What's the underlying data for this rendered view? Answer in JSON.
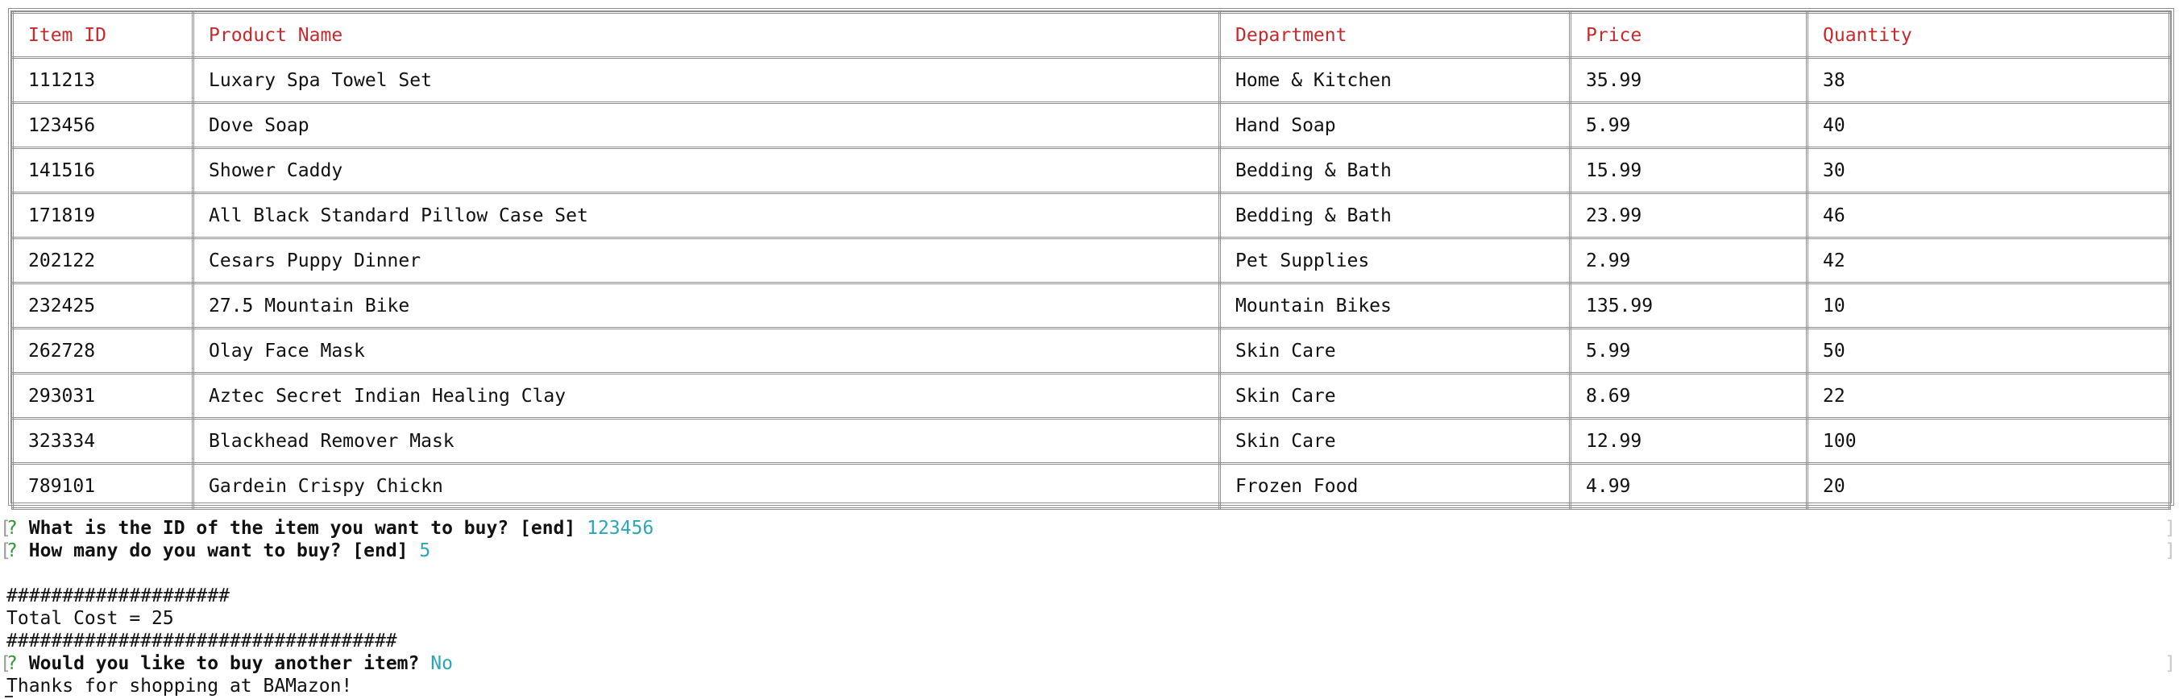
{
  "table": {
    "headers": [
      "Item ID",
      "Product Name",
      "Department",
      "Price",
      "Quantity"
    ],
    "rows": [
      [
        "111213",
        "Luxary Spa Towel Set",
        "Home & Kitchen",
        "35.99",
        "38"
      ],
      [
        "123456",
        "Dove Soap",
        "Hand Soap",
        "5.99",
        "40"
      ],
      [
        "141516",
        "Shower Caddy",
        "Bedding & Bath",
        "15.99",
        "30"
      ],
      [
        "171819",
        "All Black Standard Pillow Case Set",
        "Bedding & Bath",
        "23.99",
        "46"
      ],
      [
        "202122",
        "Cesars Puppy Dinner",
        "Pet Supplies",
        "2.99",
        "42"
      ],
      [
        "232425",
        "27.5 Mountain Bike",
        "Mountain Bikes",
        "135.99",
        "10"
      ],
      [
        "262728",
        "Olay Face Mask",
        "Skin Care",
        "5.99",
        "50"
      ],
      [
        "293031",
        "Aztec Secret Indian Healing Clay",
        "Skin Care",
        "8.69",
        "22"
      ],
      [
        "323334",
        "Blackhead Remover Mask",
        "Skin Care",
        "12.99",
        "100"
      ],
      [
        "789101",
        "Gardein Crispy Chickn",
        "Frozen Food",
        "4.99",
        "20"
      ]
    ]
  },
  "terminal": {
    "prompt1": {
      "mark": "?",
      "question": "What is the ID of the item you want to buy? [end]",
      "answer": "123456"
    },
    "prompt2": {
      "mark": "?",
      "question": "How many do you want to buy? [end]",
      "answer": "5"
    },
    "hash_top": "####################",
    "total": "Total Cost = 25",
    "hash_bottom": "###################################",
    "prompt3": {
      "mark": "?",
      "question": "Would you like to buy another item?",
      "answer": "No"
    },
    "goodbye": "Thanks for shopping at BAMazon!"
  },
  "colors": {
    "header_text": "#c8292b",
    "prompt_mark": "#2e9b2e",
    "answer_text": "#2aa7b5",
    "border": "#8f8f8f"
  }
}
